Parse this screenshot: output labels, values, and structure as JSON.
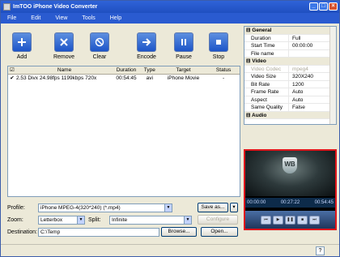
{
  "title": "ImTOO iPhone Video Converter",
  "menu": [
    "File",
    "Edit",
    "View",
    "Tools",
    "Help"
  ],
  "toolbar": {
    "add": "Add",
    "remove": "Remove",
    "clear": "Clear",
    "encode": "Encode",
    "pause": "Pause",
    "stop": "Stop"
  },
  "list": {
    "headers": [
      "Name",
      "Duration",
      "Type",
      "Target",
      "Status"
    ],
    "rows": [
      {
        "name": "2.53 Divx 24.98fps 1199kbps 720x",
        "duration": "00:54:45",
        "type": "avi",
        "target": "iPhone Movie",
        "status": "-"
      }
    ]
  },
  "form": {
    "profile_label": "Profile:",
    "profile_value": "iPhone MPEG-4(320*240)  (*.mp4)",
    "save_as": "Save as...",
    "zoom_label": "Zoom:",
    "zoom_value": "Letterbox",
    "split_label": "Split:",
    "split_value": "Infinite",
    "configure": "Configure",
    "destination_label": "Destination:",
    "destination_value": "C:\\Temp",
    "browse": "Browse...",
    "open": "Open..."
  },
  "properties": {
    "general_label": "General",
    "general": [
      {
        "k": "Duration",
        "v": "Full"
      },
      {
        "k": "Start Time",
        "v": "00:00:00"
      },
      {
        "k": "File name",
        "v": ""
      }
    ],
    "video_label": "Video",
    "video": [
      {
        "k": "Video Codec",
        "v": "mpeg4",
        "disabled": true
      },
      {
        "k": "Video Size",
        "v": "320X240"
      },
      {
        "k": "Bit Rate",
        "v": "1200"
      },
      {
        "k": "Frame Rate",
        "v": "Auto"
      },
      {
        "k": "Aspect",
        "v": "Auto"
      },
      {
        "k": "Same Quality",
        "v": "False"
      }
    ],
    "audio_label": "Audio"
  },
  "preview": {
    "t_start": "00:00:00",
    "t_mid": "00:27:22",
    "t_end": "00:54:45",
    "logo_text": "WB"
  },
  "help": "?"
}
